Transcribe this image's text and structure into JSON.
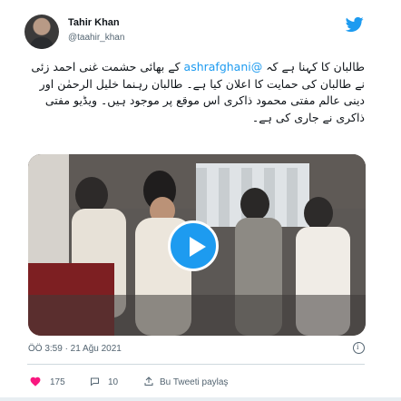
{
  "author": {
    "name": "Tahir Khan",
    "handle": "@taahir_khan"
  },
  "tweet": {
    "mention": "@ashrafghani",
    "text_before": "طالبان کا کہنا ہے کہ",
    "text_after": "کے بھائی حشمت غنی احمد زئی نے طالبان کی حمایت کا اعلان کیا ہے۔ طالبان رہنما خلیل الرحمٰن اور دینی عالم مفتی محمود ذاکری اس موقع پر موجود ہیں۔ ویڈیو مفتی ذاکری نے جاری کی ہے۔"
  },
  "media": {
    "type": "video",
    "play_icon": "play-icon"
  },
  "meta": {
    "timestamp": "ÖÖ 3:59 · 21 Ağu 2021"
  },
  "actions": {
    "likes": "175",
    "replies": "10",
    "share": "Bu Tweeti paylaş"
  },
  "colors": {
    "accent": "#1d9bf0",
    "text": "#0f1419",
    "muted": "#536471",
    "divider": "#cfd9de",
    "like": "#f91880"
  },
  "icons": [
    "twitter-bird-icon",
    "play-icon",
    "info-icon",
    "heart-icon",
    "reply-icon",
    "share-icon"
  ]
}
